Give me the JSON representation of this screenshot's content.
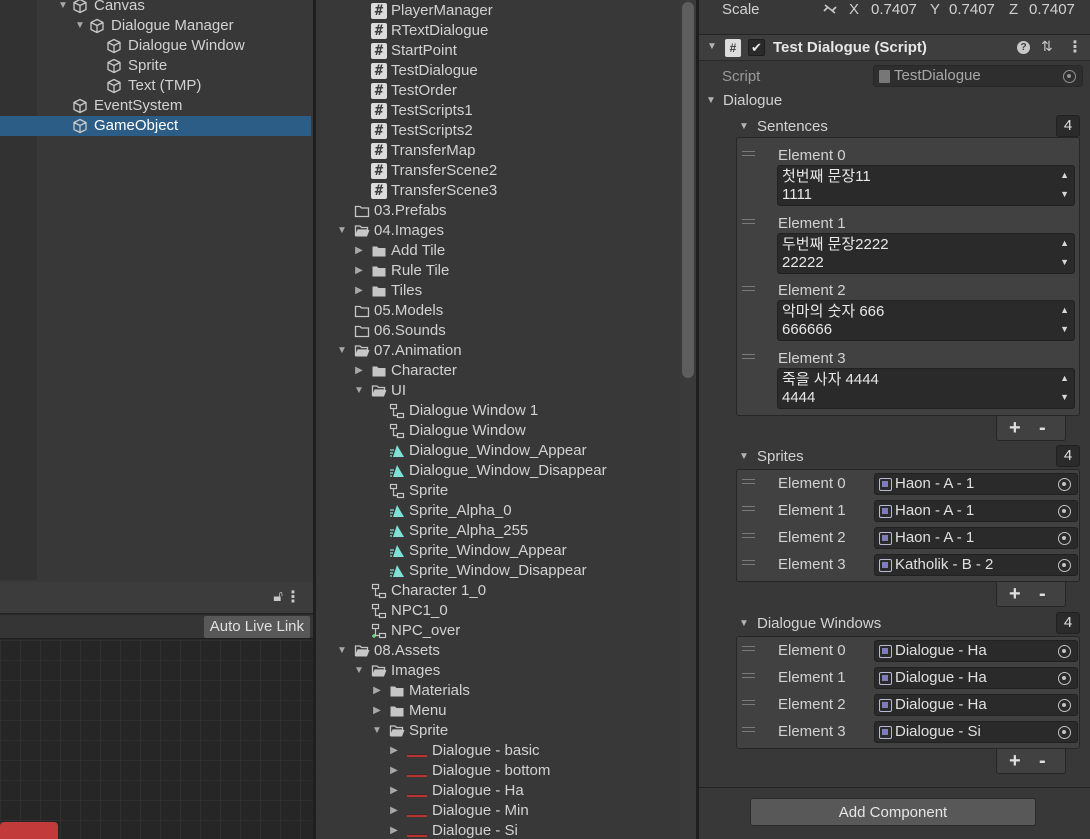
{
  "hierarchy": {
    "rows": [
      {
        "label": "Canvas",
        "depth": 0,
        "arrow": "▼",
        "selected": false
      },
      {
        "label": "Dialogue Manager",
        "depth": 1,
        "arrow": "▼",
        "selected": false
      },
      {
        "label": "Dialogue Window",
        "depth": 2,
        "arrow": "",
        "selected": false
      },
      {
        "label": "Sprite",
        "depth": 2,
        "arrow": "",
        "selected": false
      },
      {
        "label": "Text (TMP)",
        "depth": 2,
        "arrow": "",
        "selected": false
      },
      {
        "label": "EventSystem",
        "depth": 0,
        "arrow": "",
        "selected": false
      },
      {
        "label": "GameObject",
        "depth": 0,
        "arrow": "",
        "selected": true
      }
    ]
  },
  "animator": {
    "auto_live_link": "Auto Live Link"
  },
  "project": {
    "rows": [
      {
        "label": "PlayerManager",
        "indent": 1,
        "icon": "script",
        "arrow": ""
      },
      {
        "label": "RTextDialogue",
        "indent": 1,
        "icon": "script",
        "arrow": ""
      },
      {
        "label": "StartPoint",
        "indent": 1,
        "icon": "script",
        "arrow": ""
      },
      {
        "label": "TestDialogue",
        "indent": 1,
        "icon": "script",
        "arrow": ""
      },
      {
        "label": "TestOrder",
        "indent": 1,
        "icon": "script",
        "arrow": ""
      },
      {
        "label": "TestScripts1",
        "indent": 1,
        "icon": "script",
        "arrow": ""
      },
      {
        "label": "TestScripts2",
        "indent": 1,
        "icon": "script",
        "arrow": ""
      },
      {
        "label": "TransferMap",
        "indent": 1,
        "icon": "script",
        "arrow": ""
      },
      {
        "label": "TransferScene2",
        "indent": 1,
        "icon": "script",
        "arrow": ""
      },
      {
        "label": "TransferScene3",
        "indent": 1,
        "icon": "script",
        "arrow": ""
      },
      {
        "label": "03.Prefabs",
        "indent": 0,
        "icon": "folder-empty",
        "arrow": ""
      },
      {
        "label": "04.Images",
        "indent": 0,
        "icon": "folder-open",
        "arrow": "▼"
      },
      {
        "label": "Add Tile",
        "indent": 1,
        "icon": "folder",
        "arrow": "▶"
      },
      {
        "label": "Rule Tile",
        "indent": 1,
        "icon": "folder",
        "arrow": "▶"
      },
      {
        "label": "Tiles",
        "indent": 1,
        "icon": "folder",
        "arrow": "▶"
      },
      {
        "label": "05.Models",
        "indent": 0,
        "icon": "folder-empty",
        "arrow": ""
      },
      {
        "label": "06.Sounds",
        "indent": 0,
        "icon": "folder-empty",
        "arrow": ""
      },
      {
        "label": "07.Animation",
        "indent": 0,
        "icon": "folder-open",
        "arrow": "▼"
      },
      {
        "label": "Character",
        "indent": 1,
        "icon": "folder",
        "arrow": "▶"
      },
      {
        "label": "UI",
        "indent": 1,
        "icon": "folder-open",
        "arrow": "▼"
      },
      {
        "label": "Dialogue Window 1",
        "indent": 2,
        "icon": "controller",
        "arrow": ""
      },
      {
        "label": "Dialogue Window",
        "indent": 2,
        "icon": "controller",
        "arrow": ""
      },
      {
        "label": "Dialogue_Window_Appear",
        "indent": 2,
        "icon": "anim-clip",
        "arrow": ""
      },
      {
        "label": "Dialogue_Window_Disappear",
        "indent": 2,
        "icon": "anim-clip",
        "arrow": ""
      },
      {
        "label": "Sprite",
        "indent": 2,
        "icon": "controller",
        "arrow": ""
      },
      {
        "label": "Sprite_Alpha_0",
        "indent": 2,
        "icon": "anim-clip",
        "arrow": ""
      },
      {
        "label": "Sprite_Alpha_255",
        "indent": 2,
        "icon": "anim-clip",
        "arrow": ""
      },
      {
        "label": "Sprite_Window_Appear",
        "indent": 2,
        "icon": "anim-clip",
        "arrow": ""
      },
      {
        "label": "Sprite_Window_Disappear",
        "indent": 2,
        "icon": "anim-clip",
        "arrow": ""
      },
      {
        "label": "Character 1_0",
        "indent": 1,
        "icon": "controller",
        "arrow": ""
      },
      {
        "label": "NPC1_0",
        "indent": 1,
        "icon": "controller",
        "arrow": ""
      },
      {
        "label": "NPC_over",
        "indent": 1,
        "icon": "override-controller",
        "arrow": ""
      },
      {
        "label": "08.Assets",
        "indent": 0,
        "icon": "folder-open",
        "arrow": "▼"
      },
      {
        "label": "Images",
        "indent": 1,
        "icon": "folder-open",
        "arrow": "▼"
      },
      {
        "label": "Materials",
        "indent": 2,
        "icon": "folder",
        "arrow": "▶"
      },
      {
        "label": "Menu",
        "indent": 2,
        "icon": "folder",
        "arrow": "▶"
      },
      {
        "label": "Sprite",
        "indent": 2,
        "icon": "folder-open",
        "arrow": "▼"
      },
      {
        "label": "Dialogue - basic",
        "indent": 3,
        "icon": "sprite-thumb",
        "arrow": "▶"
      },
      {
        "label": "Dialogue - bottom",
        "indent": 3,
        "icon": "sprite-thumb",
        "arrow": "▶"
      },
      {
        "label": "Dialogue - Ha",
        "indent": 3,
        "icon": "sprite-thumb",
        "arrow": "▶"
      },
      {
        "label": "Dialogue - Min",
        "indent": 3,
        "icon": "sprite-thumb",
        "arrow": "▶"
      },
      {
        "label": "Dialogue - Si",
        "indent": 3,
        "icon": "sprite-thumb",
        "arrow": "▶"
      }
    ]
  },
  "inspector": {
    "scale": {
      "label": "Scale",
      "x_label": "X",
      "x": "0.7407",
      "y_label": "Y",
      "y": "0.7407",
      "z_label": "Z",
      "z": "0.7407"
    },
    "component": {
      "title": "Test Dialogue (Script)"
    },
    "script": {
      "label": "Script",
      "value": "TestDialogue"
    },
    "dialogue_label": "Dialogue",
    "sentences": {
      "label": "Sentences",
      "count": "4",
      "elements": [
        {
          "label": "Element 0",
          "line1": "첫번째 문장11",
          "line2": "1111"
        },
        {
          "label": "Element 1",
          "line1": "두번째 문장2222",
          "line2": "22222"
        },
        {
          "label": "Element 2",
          "line1": "악마의 숫자 666",
          "line2": "666666"
        },
        {
          "label": "Element 3",
          "line1": "죽을 사자 4444",
          "line2": "4444"
        }
      ]
    },
    "sprites": {
      "label": "Sprites",
      "count": "4",
      "elements": [
        {
          "label": "Element 0",
          "value": "Haon - A - 1"
        },
        {
          "label": "Element 1",
          "value": "Haon - A - 1"
        },
        {
          "label": "Element 2",
          "value": "Haon - A - 1"
        },
        {
          "label": "Element 3",
          "value": "Katholik - B - 2"
        }
      ]
    },
    "dialogue_windows": {
      "label": "Dialogue Windows",
      "count": "4",
      "elements": [
        {
          "label": "Element 0",
          "value": "Dialogue - Ha"
        },
        {
          "label": "Element 1",
          "value": "Dialogue - Ha"
        },
        {
          "label": "Element 2",
          "value": "Dialogue - Ha"
        },
        {
          "label": "Element 3",
          "value": "Dialogue - Si"
        }
      ]
    },
    "plus": "+",
    "minus": "-",
    "add_component": "Add Component"
  }
}
